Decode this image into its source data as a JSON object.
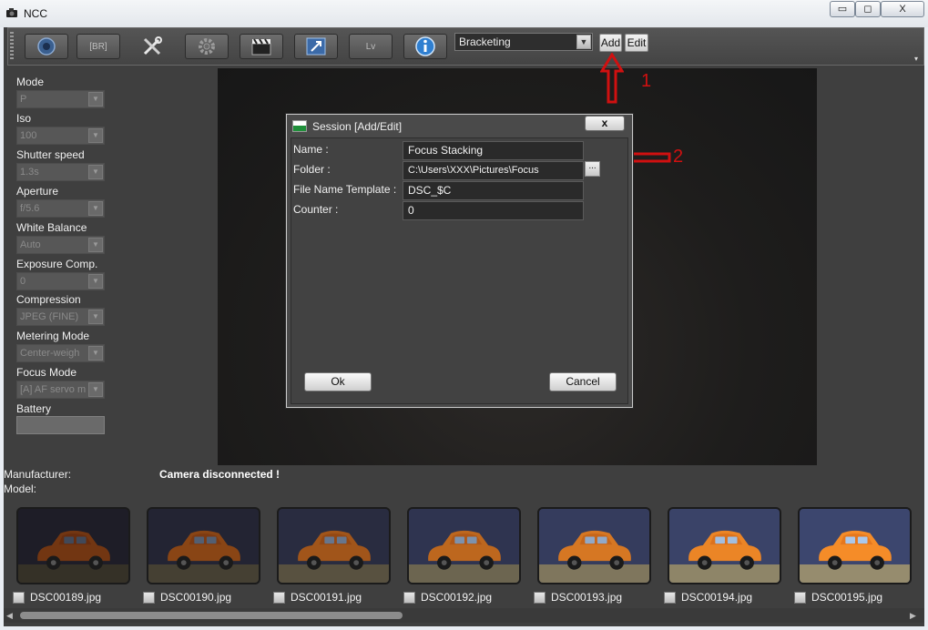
{
  "window": {
    "title": "NCC",
    "minimize": "▭",
    "maximize": "◻",
    "close": "X"
  },
  "toolbar": {
    "br_label": "[BR]",
    "lv_label": "Lv",
    "session_select": "Bracketing",
    "add_label": "Add",
    "edit_label": "Edit"
  },
  "settings": {
    "mode": {
      "label": "Mode",
      "value": "P"
    },
    "iso": {
      "label": "Iso",
      "value": "100"
    },
    "shutter": {
      "label": "Shutter speed",
      "value": "1.3s"
    },
    "aperture": {
      "label": "Aperture",
      "value": "f/5.6"
    },
    "white_balance": {
      "label": "White Balance",
      "value": "Auto"
    },
    "exposure_comp": {
      "label": "Exposure Comp.",
      "value": "0"
    },
    "compression": {
      "label": "Compression",
      "value": "JPEG (FINE)"
    },
    "metering": {
      "label": "Metering Mode",
      "value": "Center-weigh"
    },
    "focus_mode": {
      "label": "Focus Mode",
      "value": "[A] AF servo m"
    },
    "battery": {
      "label": "Battery"
    }
  },
  "camera_info": {
    "manufacturer_label": "Manufacturer:",
    "model_label": "Model:",
    "status": "Camera disconnected !"
  },
  "thumbnails": [
    {
      "file": "DSC00189.jpg",
      "brightness": 0.25
    },
    {
      "file": "DSC00190.jpg",
      "brightness": 0.38
    },
    {
      "file": "DSC00191.jpg",
      "brightness": 0.52
    },
    {
      "file": "DSC00192.jpg",
      "brightness": 0.68
    },
    {
      "file": "DSC00193.jpg",
      "brightness": 0.82
    },
    {
      "file": "DSC00194.jpg",
      "brightness": 0.94
    },
    {
      "file": "DSC00195.jpg",
      "brightness": 1.0
    }
  ],
  "annotations": {
    "one": "1",
    "two": "2"
  },
  "dialog": {
    "title": "Session [Add/Edit]",
    "close": "x",
    "name_label": "Name :",
    "name_value": "Focus Stacking",
    "folder_label": "Folder :",
    "folder_value": "C:\\Users\\XXX\\Pictures\\Focus",
    "browse": "...",
    "template_label": "File Name Template :",
    "template_value": "DSC_$C",
    "counter_label": "Counter :",
    "counter_value": "0",
    "ok": "Ok",
    "cancel": "Cancel"
  },
  "colors": {
    "accent_red": "#d01010",
    "panel": "#3f3f3f",
    "dialog": "#4a4a4a"
  }
}
